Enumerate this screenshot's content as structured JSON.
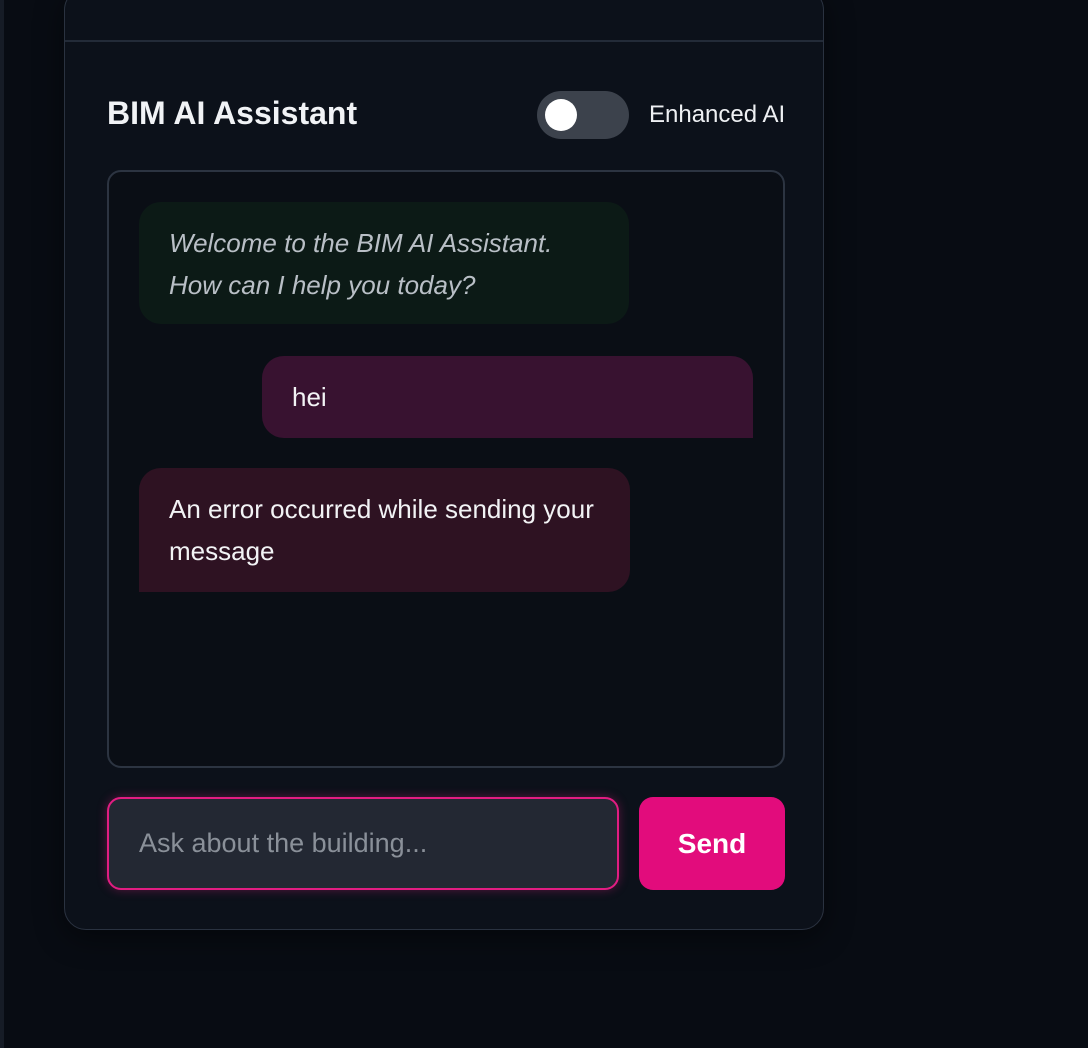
{
  "header": {
    "title": "BIM AI Assistant"
  },
  "toggle": {
    "label": "Enhanced AI",
    "enabled": false
  },
  "chat": {
    "messages": [
      {
        "role": "assistant",
        "text": "Welcome to the BIM AI Assistant. How can I help you today?"
      },
      {
        "role": "user",
        "text": "hei"
      },
      {
        "role": "error",
        "text": "An error occurred while sending your message"
      }
    ]
  },
  "input": {
    "placeholder": "Ask about the building...",
    "value": ""
  },
  "send": {
    "label": "Send"
  },
  "colors": {
    "accent": "#e20c7c",
    "background": "#080c13",
    "panel": "#0c111a"
  }
}
